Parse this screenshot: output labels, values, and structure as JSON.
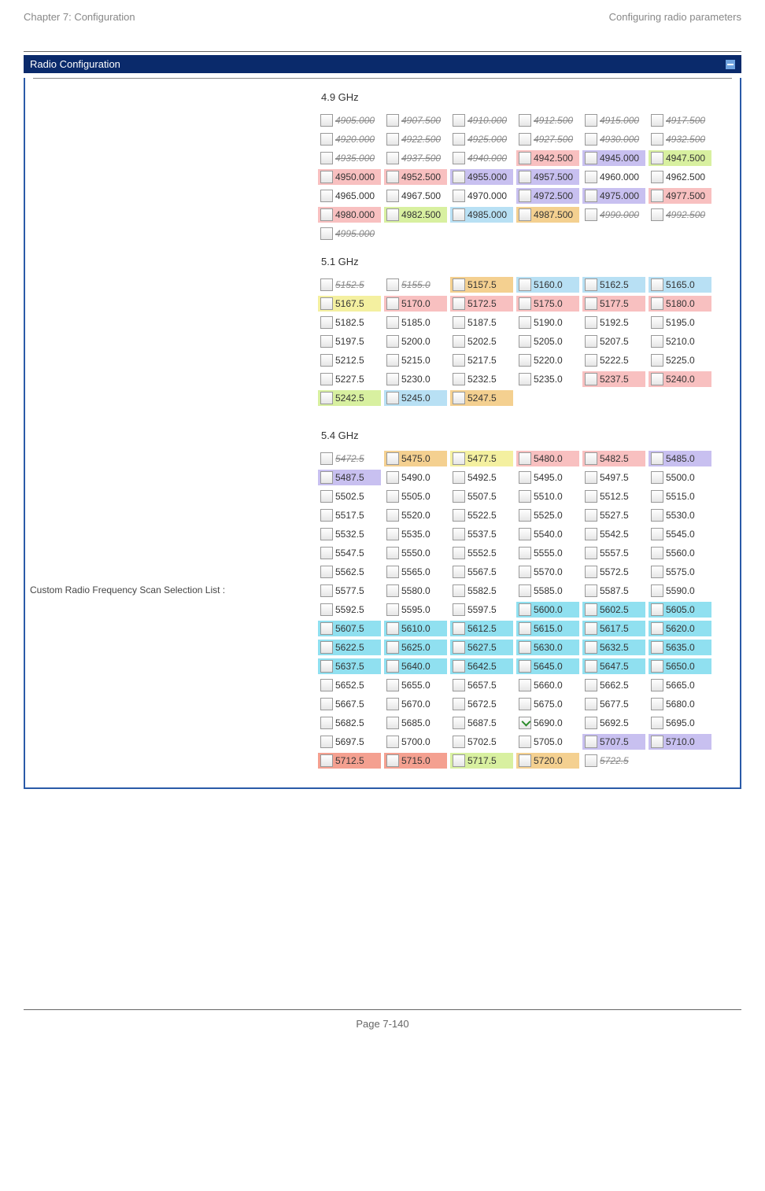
{
  "header": {
    "left": "Chapter 7:  Configuration",
    "right": "Configuring radio parameters"
  },
  "panel": {
    "title": "Radio Configuration"
  },
  "leftLabel": "Custom Radio Frequency Scan Selection List :",
  "footer": {
    "page": "Page 7-140"
  },
  "bands": [
    {
      "name": "4.9 GHz",
      "cols": 5,
      "cells": [
        {
          "v": "4905.000",
          "s": true
        },
        {
          "v": "4907.500",
          "s": true
        },
        {
          "v": "4910.000",
          "s": true
        },
        {
          "v": "4912.500",
          "s": true
        },
        {
          "v": "4915.000",
          "s": true
        },
        {
          "v": "4917.500",
          "s": true
        },
        {
          "v": "4920.000",
          "s": true
        },
        {
          "v": "4922.500",
          "s": true
        },
        {
          "v": "4925.000",
          "s": true
        },
        {
          "v": "4927.500",
          "s": true
        },
        {
          "v": "4930.000",
          "s": true
        },
        {
          "v": "4932.500",
          "s": true
        },
        {
          "v": "4935.000",
          "s": true
        },
        {
          "v": "4937.500",
          "s": true
        },
        {
          "v": "4940.000",
          "s": true
        },
        {
          "v": "4942.500",
          "c": "pink"
        },
        {
          "v": "4945.000",
          "c": "lavender"
        },
        {
          "v": "4947.500",
          "c": "green"
        },
        {
          "v": "4950.000",
          "c": "pink"
        },
        {
          "v": "4952.500",
          "c": "pink"
        },
        {
          "v": "4955.000",
          "c": "lavender"
        },
        {
          "v": "4957.500",
          "c": "lavender"
        },
        {
          "v": "4960.000"
        },
        {
          "v": "4962.500"
        },
        {
          "v": "4965.000"
        },
        {
          "v": "4967.500"
        },
        {
          "v": "4970.000"
        },
        {
          "v": "4972.500",
          "c": "lavender"
        },
        {
          "v": "4975.000",
          "c": "lavender"
        },
        {
          "v": "4977.500",
          "c": "pink"
        },
        {
          "v": "4980.000",
          "c": "pink"
        },
        {
          "v": "4982.500",
          "c": "green"
        },
        {
          "v": "4985.000",
          "c": "sky"
        },
        {
          "v": "4987.500",
          "c": "orange"
        },
        {
          "v": "4990.000",
          "s": true
        },
        {
          "v": "4992.500",
          "s": true
        },
        {
          "v": "4995.000",
          "s": true
        }
      ]
    },
    {
      "name": "5.1 GHz",
      "cols": 7,
      "cells": [
        {
          "v": "5152.5",
          "s": true
        },
        {
          "v": "5155.0",
          "s": true
        },
        {
          "v": "5157.5",
          "c": "orange"
        },
        {
          "v": "5160.0",
          "c": "sky"
        },
        {
          "v": "5162.5",
          "c": "sky"
        },
        {
          "v": "5165.0",
          "c": "sky"
        },
        {
          "v": "5167.5",
          "c": "yellow"
        },
        {
          "v": "5170.0",
          "c": "pink"
        },
        {
          "v": "5172.5",
          "c": "pink"
        },
        {
          "v": "5175.0",
          "c": "pink"
        },
        {
          "v": "5177.5",
          "c": "pink"
        },
        {
          "v": "5180.0",
          "c": "pink"
        },
        {
          "v": "5182.5"
        },
        {
          "v": "5185.0"
        },
        {
          "v": "5187.5"
        },
        {
          "v": "5190.0"
        },
        {
          "v": "5192.5"
        },
        {
          "v": "5195.0"
        },
        {
          "v": "5197.5"
        },
        {
          "v": "5200.0"
        },
        {
          "v": "5202.5"
        },
        {
          "v": "5205.0"
        },
        {
          "v": "5207.5"
        },
        {
          "v": "5210.0"
        },
        {
          "v": "5212.5"
        },
        {
          "v": "5215.0"
        },
        {
          "v": "5217.5"
        },
        {
          "v": "5220.0"
        },
        {
          "v": "5222.5"
        },
        {
          "v": "5225.0"
        },
        {
          "v": "5227.5"
        },
        {
          "v": "5230.0"
        },
        {
          "v": "5232.5"
        },
        {
          "v": "5235.0"
        },
        {
          "v": "5237.5",
          "c": "pink"
        },
        {
          "v": "5240.0",
          "c": "pink"
        },
        {
          "v": "5242.5",
          "c": "green"
        },
        {
          "v": "5245.0",
          "c": "sky"
        },
        {
          "v": "5247.5",
          "c": "orange"
        }
      ]
    },
    {
      "name": "5.4 GHz",
      "cols": 7,
      "cells": [
        {
          "v": "5472.5",
          "s": true
        },
        {
          "v": "5475.0",
          "c": "orange"
        },
        {
          "v": "5477.5",
          "c": "yellow"
        },
        {
          "v": "5480.0",
          "c": "pink"
        },
        {
          "v": "5482.5",
          "c": "pink"
        },
        {
          "v": "5485.0",
          "c": "lavender"
        },
        {
          "v": "5487.5",
          "c": "lavender"
        },
        {
          "v": "5490.0"
        },
        {
          "v": "5492.5"
        },
        {
          "v": "5495.0"
        },
        {
          "v": "5497.5"
        },
        {
          "v": "5500.0"
        },
        {
          "v": "5502.5"
        },
        {
          "v": "5505.0"
        },
        {
          "v": "5507.5"
        },
        {
          "v": "5510.0"
        },
        {
          "v": "5512.5"
        },
        {
          "v": "5515.0"
        },
        {
          "v": "5517.5"
        },
        {
          "v": "5520.0"
        },
        {
          "v": "5522.5"
        },
        {
          "v": "5525.0"
        },
        {
          "v": "5527.5"
        },
        {
          "v": "5530.0"
        },
        {
          "v": "5532.5"
        },
        {
          "v": "5535.0"
        },
        {
          "v": "5537.5"
        },
        {
          "v": "5540.0"
        },
        {
          "v": "5542.5"
        },
        {
          "v": "5545.0"
        },
        {
          "v": "5547.5"
        },
        {
          "v": "5550.0"
        },
        {
          "v": "5552.5"
        },
        {
          "v": "5555.0"
        },
        {
          "v": "5557.5"
        },
        {
          "v": "5560.0"
        },
        {
          "v": "5562.5"
        },
        {
          "v": "5565.0"
        },
        {
          "v": "5567.5"
        },
        {
          "v": "5570.0"
        },
        {
          "v": "5572.5"
        },
        {
          "v": "5575.0"
        },
        {
          "v": "5577.5"
        },
        {
          "v": "5580.0"
        },
        {
          "v": "5582.5"
        },
        {
          "v": "5585.0"
        },
        {
          "v": "5587.5"
        },
        {
          "v": "5590.0"
        },
        {
          "v": "5592.5"
        },
        {
          "v": "5595.0"
        },
        {
          "v": "5597.5"
        },
        {
          "v": "5600.0",
          "c": "cyan"
        },
        {
          "v": "5602.5",
          "c": "cyan"
        },
        {
          "v": "5605.0",
          "c": "cyan"
        },
        {
          "v": "5607.5",
          "c": "cyan"
        },
        {
          "v": "5610.0",
          "c": "cyan"
        },
        {
          "v": "5612.5",
          "c": "cyan"
        },
        {
          "v": "5615.0",
          "c": "cyan"
        },
        {
          "v": "5617.5",
          "c": "cyan"
        },
        {
          "v": "5620.0",
          "c": "cyan"
        },
        {
          "v": "5622.5",
          "c": "cyan"
        },
        {
          "v": "5625.0",
          "c": "cyan"
        },
        {
          "v": "5627.5",
          "c": "cyan"
        },
        {
          "v": "5630.0",
          "c": "cyan"
        },
        {
          "v": "5632.5",
          "c": "cyan"
        },
        {
          "v": "5635.0",
          "c": "cyan"
        },
        {
          "v": "5637.5",
          "c": "cyan"
        },
        {
          "v": "5640.0",
          "c": "cyan"
        },
        {
          "v": "5642.5",
          "c": "cyan"
        },
        {
          "v": "5645.0",
          "c": "cyan"
        },
        {
          "v": "5647.5",
          "c": "cyan"
        },
        {
          "v": "5650.0",
          "c": "cyan"
        },
        {
          "v": "5652.5"
        },
        {
          "v": "5655.0"
        },
        {
          "v": "5657.5"
        },
        {
          "v": "5660.0"
        },
        {
          "v": "5662.5"
        },
        {
          "v": "5665.0"
        },
        {
          "v": "5667.5"
        },
        {
          "v": "5670.0"
        },
        {
          "v": "5672.5"
        },
        {
          "v": "5675.0"
        },
        {
          "v": "5677.5"
        },
        {
          "v": "5680.0"
        },
        {
          "v": "5682.5"
        },
        {
          "v": "5685.0"
        },
        {
          "v": "5687.5"
        },
        {
          "v": "5690.0",
          "k": true
        },
        {
          "v": "5692.5"
        },
        {
          "v": "5695.0"
        },
        {
          "v": "5697.5"
        },
        {
          "v": "5700.0"
        },
        {
          "v": "5702.5"
        },
        {
          "v": "5705.0"
        },
        {
          "v": "5707.5",
          "c": "lavender"
        },
        {
          "v": "5710.0",
          "c": "lavender"
        },
        {
          "v": "5712.5",
          "c": "salmon"
        },
        {
          "v": "5715.0",
          "c": "salmon"
        },
        {
          "v": "5717.5",
          "c": "green"
        },
        {
          "v": "5720.0",
          "c": "orange"
        },
        {
          "v": "5722.5",
          "s": true
        }
      ]
    }
  ]
}
